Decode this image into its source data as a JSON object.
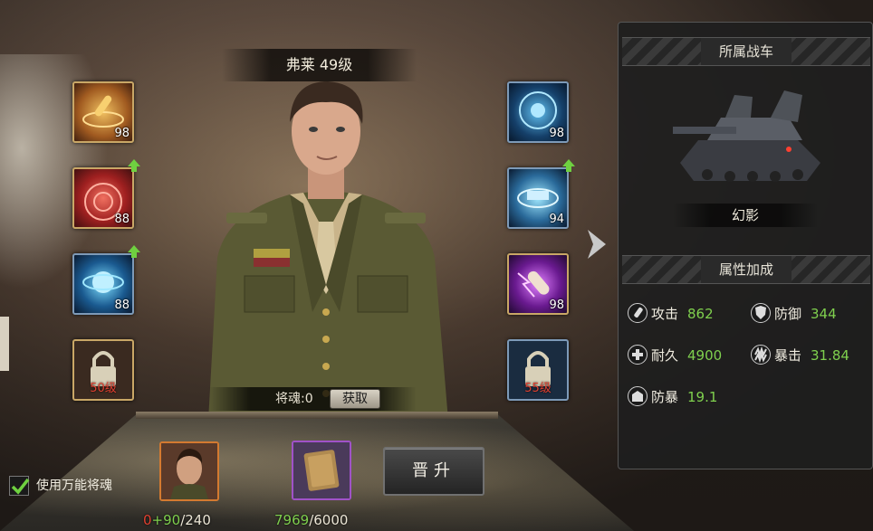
{
  "general": {
    "name_level": "弗莱 49级"
  },
  "skills_left": [
    {
      "level": "98",
      "icon": "bullet-skill-icon",
      "upgradable": false
    },
    {
      "level": "88",
      "icon": "radar-skill-icon",
      "upgradable": true
    },
    {
      "level": "88",
      "icon": "energy-core-skill-icon",
      "upgradable": true
    },
    {
      "lock_level": "50级",
      "icon": "lock-icon",
      "locked": true
    }
  ],
  "skills_right": [
    {
      "level": "98",
      "icon": "target-skill-icon",
      "upgradable": false
    },
    {
      "level": "94",
      "icon": "tank-shield-skill-icon",
      "upgradable": true
    },
    {
      "level": "98",
      "icon": "lightning-shell-skill-icon",
      "upgradable": false
    },
    {
      "lock_level": "55级",
      "icon": "lock-icon",
      "locked": true
    }
  ],
  "soul": {
    "label": "将魂:0",
    "get_button": "获取"
  },
  "universal_soul": {
    "label": "使用万能将魂",
    "checked": true
  },
  "soul_item": {
    "base": "0",
    "plus": "+90",
    "total": "/240"
  },
  "book_item": {
    "have": "7969",
    "need": "/6000"
  },
  "promote_button": "晋升",
  "panel": {
    "tank_header": "所属战车",
    "tank_name": "幻影",
    "attr_header": "属性加成",
    "attributes": [
      {
        "icon": "attack-icon",
        "name": "攻击",
        "value": "862"
      },
      {
        "icon": "defense-icon",
        "name": "防御",
        "value": "344"
      },
      {
        "icon": "durability-icon",
        "name": "耐久",
        "value": "4900"
      },
      {
        "icon": "crit-icon",
        "name": "暴击",
        "value": "31.84"
      },
      {
        "icon": "crit-defense-icon",
        "name": "防暴",
        "value": "19.1"
      }
    ]
  },
  "colors": {
    "accent_green": "#7fd04e",
    "lock_red": "#e04030",
    "gold_border": "#c9a766"
  }
}
